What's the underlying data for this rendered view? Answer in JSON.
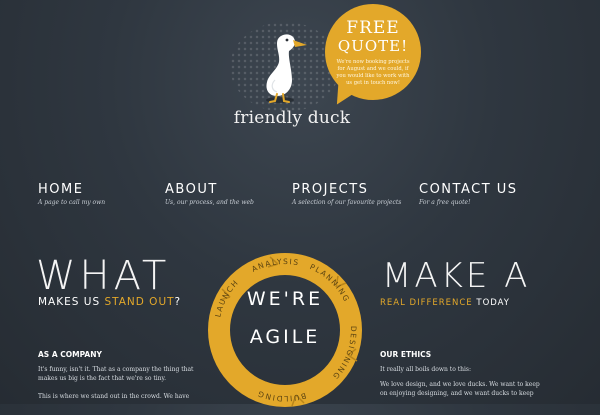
{
  "header": {
    "logo_text": "friendly duck",
    "quote": {
      "title_line1": "FREE",
      "title_line2": "QUOTE!",
      "body": "We're now booking projects for August and we could, if you would like to work with us get in touch now!"
    }
  },
  "nav": {
    "items": [
      {
        "title": "HOME",
        "subtitle": "A page to call my own"
      },
      {
        "title": "ABOUT",
        "subtitle": "Us, our process, and the web"
      },
      {
        "title": "PROJECTS",
        "subtitle": "A selection of our favourite projects"
      },
      {
        "title": "CONTACT US",
        "subtitle": "For a free quote!"
      }
    ]
  },
  "left": {
    "headline": "WHAT",
    "subhead_prefix": "MAKES US ",
    "subhead_accent": "STAND OUT",
    "subhead_suffix": "?",
    "section_title": "AS A COMPANY",
    "para1": "It's funny, isn't it. That as a company the thing that makes us big is the fact that we're so tiny.",
    "para2": "This is where we stand out in the crowd. We have"
  },
  "right": {
    "headline": "MAKE A",
    "subhead_accent": "REAL DIFFERENCE",
    "subhead_suffix": " TODAY",
    "section_title": "OUR ETHICS",
    "para1": "It really all boils down to this:",
    "para2": "We love design, and we love ducks. We want to keep on enjoying designing, and we want ducks to keep"
  },
  "ring": {
    "line1": "WE'RE",
    "line2": "AGILE",
    "segments": [
      "LAUNCH",
      "ANALYSIS",
      "PLANNING",
      "DESIGNING",
      "BUILDING"
    ]
  },
  "colors": {
    "accent": "#e3a82a",
    "background": "#2f3740",
    "text": "#ffffff"
  }
}
